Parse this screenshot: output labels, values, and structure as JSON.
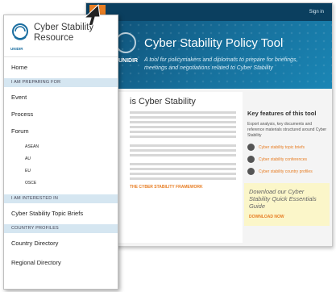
{
  "background_page": {
    "menu_button_icon": "≡",
    "sign_in": "Sign in",
    "hero": {
      "logo_text": "UNIDIR",
      "title": "Cyber Stability Policy Tool",
      "subtitle": "A tool for policymakers and diplomats to prepare for briefings, meetings and negotiations related to Cyber Stability"
    },
    "main": {
      "title": "is Cyber Stability",
      "link": "THE CYBER STABILITY FRAMEWORK"
    },
    "side": {
      "title": "Key features of this tool",
      "text": "Export analysis, key documents and reference materials structured around Cyber Stability",
      "items": [
        {
          "label": "Cyber stability topic briefs",
          "icon": "document-icon"
        },
        {
          "label": "Cyber stability conferences",
          "icon": "calendar-icon"
        },
        {
          "label": "Cyber stability country profiles",
          "icon": "globe-icon"
        }
      ],
      "promo_title": "Download our Cyber Stability Quick Essentials Guide",
      "promo_link": "DOWNLOAD NOW"
    }
  },
  "menu": {
    "title": "Cyber Stability Resource",
    "logo_text": "UNIDIR",
    "home": "Home",
    "section_preparing": "I AM PREPARING FOR",
    "event": "Event",
    "process": "Process",
    "forum": "Forum",
    "forums": [
      "ASEAN",
      "AU",
      "EU",
      "OSCE"
    ],
    "section_interested": "I AM INTERESTED IN",
    "topic_briefs": "Cyber Stability Topic Briefs",
    "section_profiles": "COUNTRY PROFILES",
    "country_directory": "Country Directory",
    "regional_directory": "Regional Directory"
  },
  "colors": {
    "accent": "#e77d23",
    "header": "#0b3f5f",
    "section_bg": "#d5e6f1"
  }
}
